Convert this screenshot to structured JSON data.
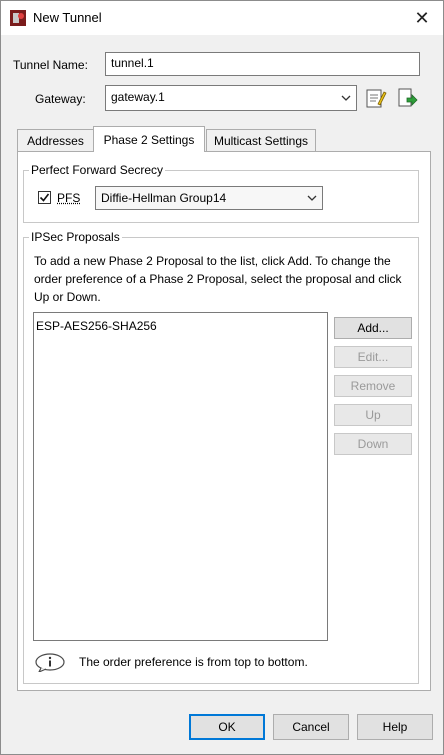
{
  "window": {
    "title": "New Tunnel",
    "close_glyph": "✕",
    "app_icon": "firebox-app-icon"
  },
  "form": {
    "tunnel_name_label": "Tunnel Name:",
    "tunnel_name_value": "tunnel.1",
    "gateway_label": "Gateway:",
    "gateway_value": "gateway.1"
  },
  "tabs": [
    {
      "label": "Addresses",
      "active": false
    },
    {
      "label": "Phase 2 Settings",
      "active": true
    },
    {
      "label": "Multicast Settings",
      "active": false
    }
  ],
  "pfs": {
    "group_title": "Perfect Forward Secrecy",
    "checkbox_label": "PFS",
    "checked": true,
    "dh_group": "Diffie-Hellman Group14"
  },
  "ipsec": {
    "group_title": "IPSec Proposals",
    "description": "To add a new Phase 2 Proposal to the list, click Add. To change the order preference of a Phase 2 Proposal, select the proposal and click Up or Down.",
    "proposals": [
      "ESP-AES256-SHA256"
    ],
    "buttons": {
      "add": "Add...",
      "edit": "Edit...",
      "remove": "Remove",
      "up": "Up",
      "down": "Down"
    },
    "info_text": "The order preference is from top to bottom."
  },
  "dialog_buttons": {
    "ok": "OK",
    "cancel": "Cancel",
    "help": "Help"
  },
  "colors": {
    "accent": "#0078d7",
    "panel": "#ffffff",
    "chrome": "#f0f0f0"
  }
}
